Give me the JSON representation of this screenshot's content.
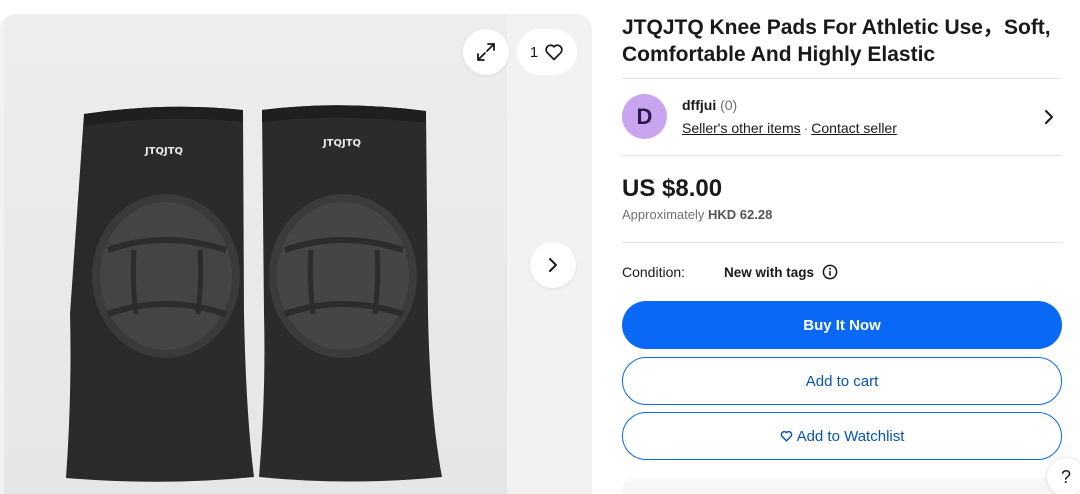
{
  "gallery": {
    "watch_count": "1",
    "pad_brand_text": "JTQJTQ"
  },
  "listing": {
    "title": "JTQJTQ Knee Pads For Athletic Use，Soft, Comfortable And Highly Elastic"
  },
  "seller": {
    "avatar_letter": "D",
    "name": "dffjui",
    "feedback_count": "(0)",
    "other_items_label": "Seller's other items",
    "separator": "·",
    "contact_label": "Contact seller"
  },
  "price": {
    "amount": "US $8.00",
    "approx_label": "Approximately",
    "approx_value": "HKD 62.28"
  },
  "condition": {
    "label": "Condition:",
    "value": "New with tags"
  },
  "actions": {
    "buy_now": "Buy It Now",
    "add_to_cart": "Add to cart",
    "add_to_watchlist": "Add to Watchlist"
  },
  "help": {
    "label": "?"
  },
  "colors": {
    "primary_blue": "#0968f6",
    "link_blue": "#0654ba",
    "avatar_purple": "#c9a5f0"
  },
  "icons": [
    "expand-icon",
    "heart-icon",
    "chevron-right-icon",
    "info-icon",
    "heart-outline-icon"
  ]
}
